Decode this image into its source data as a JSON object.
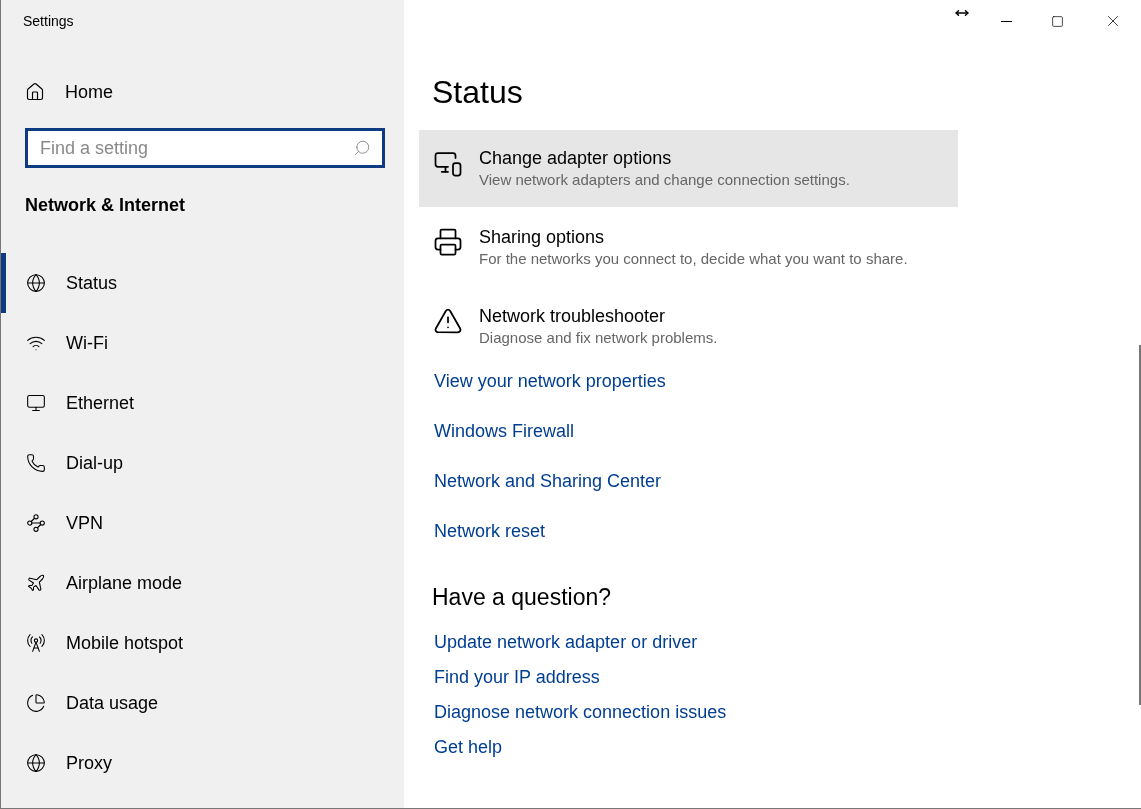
{
  "window": {
    "title": "Settings"
  },
  "sidebar": {
    "home": "Home",
    "search": {
      "placeholder": "Find a setting"
    },
    "section": "Network & Internet",
    "items": [
      {
        "label": "Status",
        "kind": "status",
        "selected": true
      },
      {
        "label": "Wi-Fi",
        "kind": "wifi",
        "selected": false
      },
      {
        "label": "Ethernet",
        "kind": "ethernet",
        "selected": false
      },
      {
        "label": "Dial-up",
        "kind": "dialup",
        "selected": false
      },
      {
        "label": "VPN",
        "kind": "vpn",
        "selected": false
      },
      {
        "label": "Airplane mode",
        "kind": "airplane",
        "selected": false
      },
      {
        "label": "Mobile hotspot",
        "kind": "hotspot",
        "selected": false
      },
      {
        "label": "Data usage",
        "kind": "data",
        "selected": false
      },
      {
        "label": "Proxy",
        "kind": "proxy",
        "selected": false
      }
    ]
  },
  "main": {
    "heading": "Status",
    "options": [
      {
        "kind": "adapter",
        "title": "Change adapter options",
        "description": "View network adapters and change connection settings.",
        "highlighted": true
      },
      {
        "kind": "sharing",
        "title": "Sharing options",
        "description": "For the networks you connect to, decide what you want to share.",
        "highlighted": false
      },
      {
        "kind": "warning",
        "title": "Network troubleshooter",
        "description": "Diagnose and fix network problems.",
        "highlighted": false
      }
    ],
    "links": [
      "View your network properties",
      "Windows Firewall",
      "Network and Sharing Center",
      "Network reset"
    ],
    "question": {
      "heading": "Have a question?",
      "links": [
        "Update network adapter or driver",
        "Find your IP address",
        "Diagnose network connection issues",
        "Get help"
      ]
    }
  }
}
